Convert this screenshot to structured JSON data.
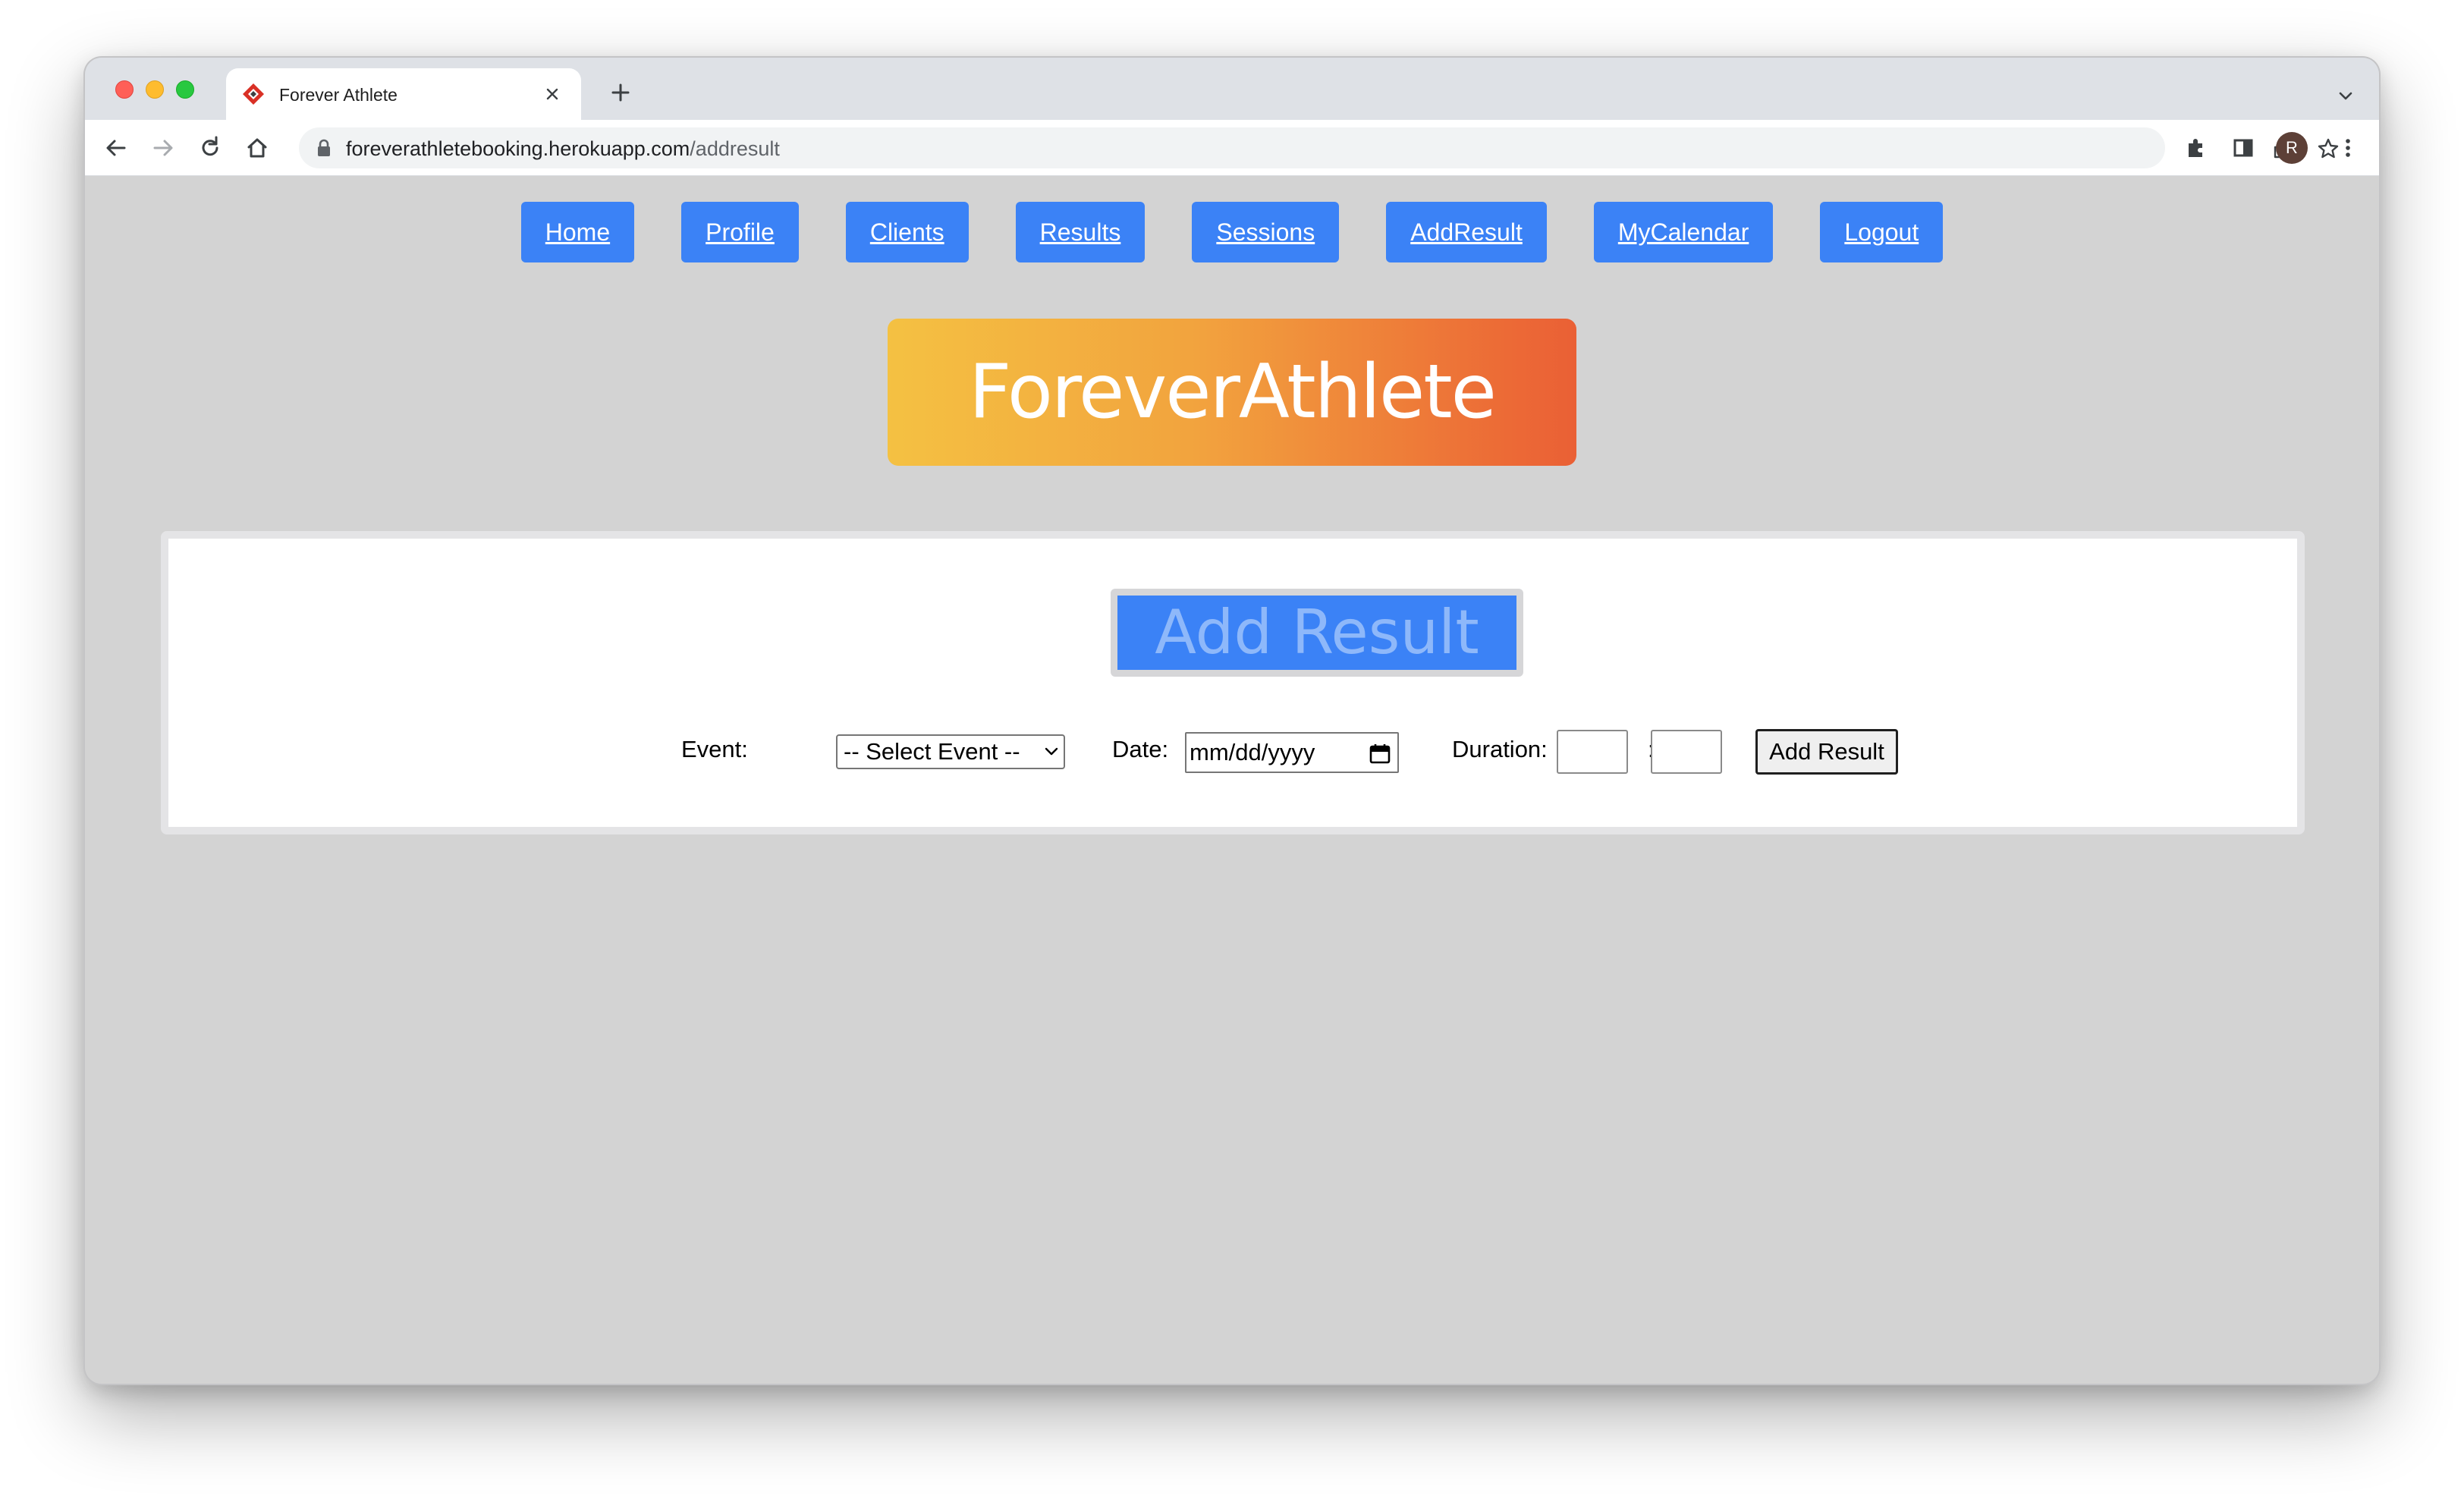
{
  "browser": {
    "tab_title": "Forever Athlete",
    "url_host": "foreverathletebooking.herokuapp.com",
    "url_path": "/addresult",
    "profile_initial": "R",
    "icons": [
      "back-icon",
      "forward-icon",
      "reload-icon",
      "home-icon",
      "lock-icon",
      "share-icon",
      "star-icon",
      "extensions-icon",
      "side-panel-icon",
      "more-menu-icon",
      "new-tab-icon",
      "close-icon",
      "tab-search-icon"
    ]
  },
  "nav": {
    "items": [
      {
        "label": "Home"
      },
      {
        "label": "Profile"
      },
      {
        "label": "Clients"
      },
      {
        "label": "Results"
      },
      {
        "label": "Sessions"
      },
      {
        "label": "AddResult"
      },
      {
        "label": "MyCalendar"
      },
      {
        "label": "Logout"
      }
    ]
  },
  "brand": {
    "title": "ForeverAthlete"
  },
  "form": {
    "title": "Add Result",
    "event_label": "Event:",
    "event_selected": "-- Select Event --",
    "date_label": "Date:",
    "date_placeholder": "mm/dd/yyyy",
    "duration_label": "Duration:",
    "duration_separator": ":",
    "submit_label": "Add Result"
  },
  "colors": {
    "nav_button": "#3b82f6",
    "page_background": "#d3d3d3",
    "brand_gradient_start": "#f4c142",
    "brand_gradient_end": "#ea6035"
  }
}
